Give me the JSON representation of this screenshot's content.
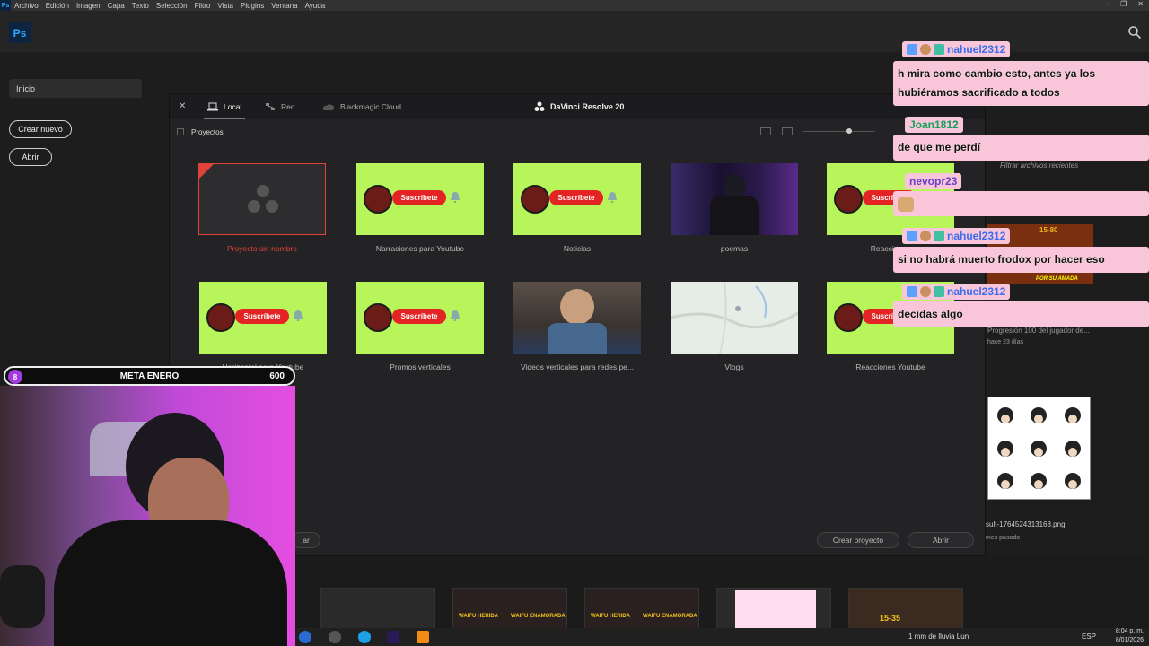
{
  "menubar": {
    "items": [
      "Archivo",
      "Edición",
      "Imagen",
      "Capa",
      "Texto",
      "Selección",
      "Filtro",
      "Vista",
      "Plugins",
      "Ventana",
      "Ayuda"
    ]
  },
  "app": {
    "logo": "Ps"
  },
  "left_panel": {
    "inicio": "Inicio",
    "create": "Crear nuevo",
    "open": "Abrir"
  },
  "davinci": {
    "tabs": [
      "Local",
      "Red",
      "Blackmagic Cloud"
    ],
    "title": "DaVinci Resolve 20",
    "section": "Proyectos",
    "projects": [
      {
        "name": "Proyecto sin nombre",
        "kind": "empty"
      },
      {
        "name": "Narraciones para Youtube",
        "kind": "subscribe"
      },
      {
        "name": "Noticias",
        "kind": "subscribe"
      },
      {
        "name": "poemas",
        "kind": "photo"
      },
      {
        "name": "Reacciones",
        "kind": "subscribe"
      },
      {
        "name": "Horizontal para Youtube",
        "kind": "subscribe"
      },
      {
        "name": "Promos verticales",
        "kind": "subscribe"
      },
      {
        "name": "Videos verticales para redes pe...",
        "kind": "photo2"
      },
      {
        "name": "Vlogs",
        "kind": "map"
      },
      {
        "name": "Reacciones  Youtube",
        "kind": "subscribe"
      }
    ],
    "subscribe_label": "Suscríbete",
    "create_project": "Crear proyecto",
    "open": "Abrir",
    "cancel_partial": "ar"
  },
  "goal": {
    "count": "8",
    "title": "META ENERO",
    "value": "600"
  },
  "right_panel": {
    "filter": "Filtrar archivos recientes",
    "item1": "Progresión 100 del jugador de...",
    "item1_time": "hace 23 días",
    "file": "sult-1764524313168.png",
    "file_time": "mes pasado",
    "thumb_text": "POR SU AMADA",
    "thumb_num": "15-80"
  },
  "chat": [
    {
      "user": "nahuel2312",
      "msg": "h mira como cambio esto, antes ya los hubiéramos sacrificado a todos"
    },
    {
      "user": "Joan1812",
      "msg": "de que me perdí"
    },
    {
      "user": "nevopr23",
      "msg": ""
    },
    {
      "user": "nahuel2312",
      "msg": "si no habrá muerto frodox por hacer eso"
    },
    {
      "user": "nahuel2312",
      "msg": "decidas algo"
    }
  ],
  "strip": {
    "label1": "WAIFU HERIDA",
    "label2": "WAIFU ENAMORADA",
    "label3": "15-35"
  },
  "taskbar": {
    "weather": "1 mm de lluvia Lun",
    "lang": "ESP",
    "time": "8:04 p. m.",
    "date": "8/01/2026"
  },
  "colors": {
    "lime": "#b8f55a",
    "red": "#e42424",
    "pink": "#f8c6d8",
    "accent": "#31a8ff"
  }
}
